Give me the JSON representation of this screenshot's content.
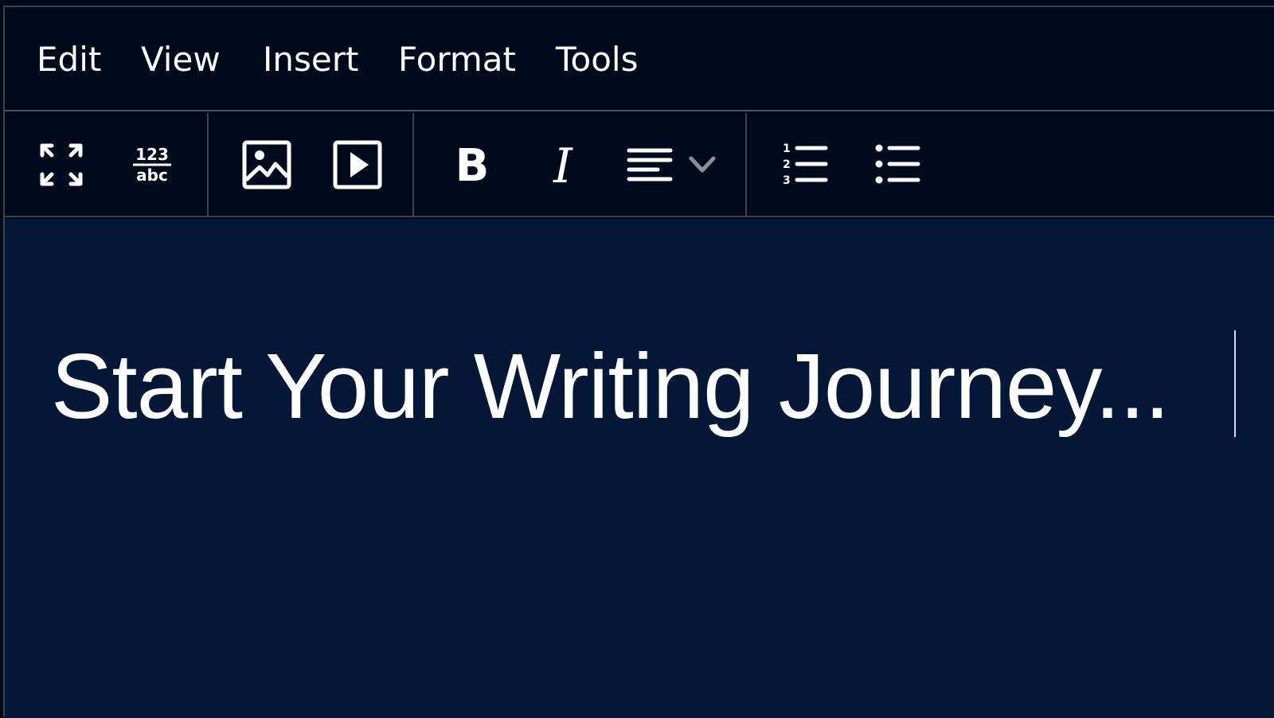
{
  "menubar": {
    "items": [
      {
        "label": "Edit"
      },
      {
        "label": "View"
      },
      {
        "label": "Insert"
      },
      {
        "label": "Format"
      },
      {
        "label": "Tools"
      }
    ]
  },
  "toolbar": {
    "buttons": [
      {
        "icon": "fullscreen-icon"
      },
      {
        "icon": "word-count-icon",
        "top_text": "123",
        "bottom_text": "abc"
      },
      {
        "icon": "image-icon"
      },
      {
        "icon": "media-icon"
      },
      {
        "icon": "bold-icon",
        "glyph": "B"
      },
      {
        "icon": "italic-icon",
        "glyph": "I"
      },
      {
        "icon": "align-left-icon"
      },
      {
        "icon": "numbered-list-icon",
        "numbers": [
          "1",
          "2",
          "3"
        ]
      },
      {
        "icon": "bullet-list-icon"
      }
    ]
  },
  "document": {
    "text": "Start Your Writing Journey..."
  },
  "colors": {
    "background": "#000a1d",
    "content": "#031837",
    "text": "#ffffff",
    "divider": "#3a4350",
    "chevron": "#8a9099"
  }
}
